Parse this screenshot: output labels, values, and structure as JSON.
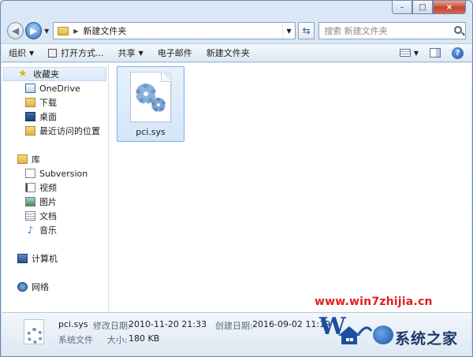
{
  "window": {
    "caption": {
      "minimize": "–",
      "maximize": "□",
      "close": "×"
    }
  },
  "address_bar": {
    "path": "新建文件夹",
    "search_placeholder": "搜索 新建文件夹"
  },
  "toolbar": {
    "organize": "组织",
    "open_with": "打开方式...",
    "share": "共享",
    "email": "电子邮件",
    "new_folder": "新建文件夹"
  },
  "sidebar": {
    "favorites": {
      "label": "收藏夹",
      "items": [
        {
          "label": "OneDrive"
        },
        {
          "label": "下载"
        },
        {
          "label": "桌面"
        },
        {
          "label": "最近访问的位置"
        }
      ]
    },
    "libraries": {
      "label": "库",
      "items": [
        {
          "label": "Subversion"
        },
        {
          "label": "视频"
        },
        {
          "label": "图片"
        },
        {
          "label": "文档"
        },
        {
          "label": "音乐"
        }
      ]
    },
    "computer": {
      "label": "计算机"
    },
    "network": {
      "label": "网络"
    }
  },
  "files": [
    {
      "name": "pci.sys",
      "icon": "system-file-gear-icon"
    }
  ],
  "details": {
    "name": "pci.sys",
    "type": "系统文件",
    "modified_label": "修改日期:",
    "modified_value": "2010-11-20 21:33",
    "created_label": "创建日期:",
    "created_value": "2016-09-02 11:19",
    "size_label": "大小:",
    "size_value": "180 KB"
  },
  "watermark": {
    "url": "www.win7zhijia.cn",
    "site_name": "系统之家"
  }
}
